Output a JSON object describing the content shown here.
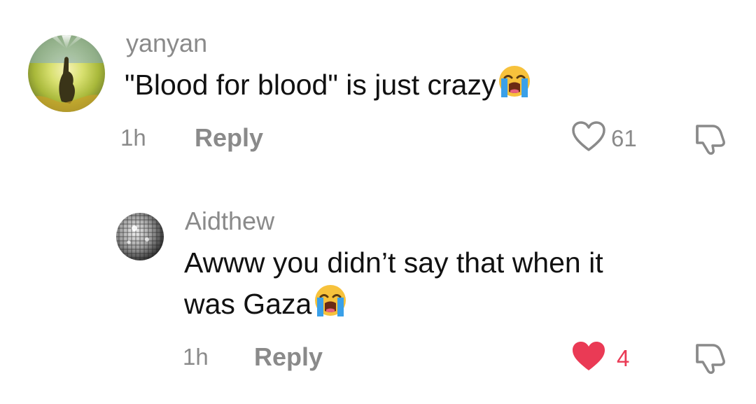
{
  "comments": [
    {
      "username": "yanyan",
      "text": "\"Blood for blood\" is just crazy",
      "emoji": "loudly-crying-face",
      "time": "1h",
      "reply_label": "Reply",
      "likes": "61",
      "liked": false
    },
    {
      "username": "Aidthew",
      "text_line1": "Awww you didn’t say that when it",
      "text_line2": "was Gaza",
      "emoji": "loudly-crying-face",
      "time": "1h",
      "reply_label": "Reply",
      "likes": "4",
      "liked": true
    }
  ],
  "colors": {
    "muted": "#8a8a8a",
    "text": "#111111",
    "liked_heart": "#ea3a55",
    "liked_count": "#ea3a55"
  }
}
